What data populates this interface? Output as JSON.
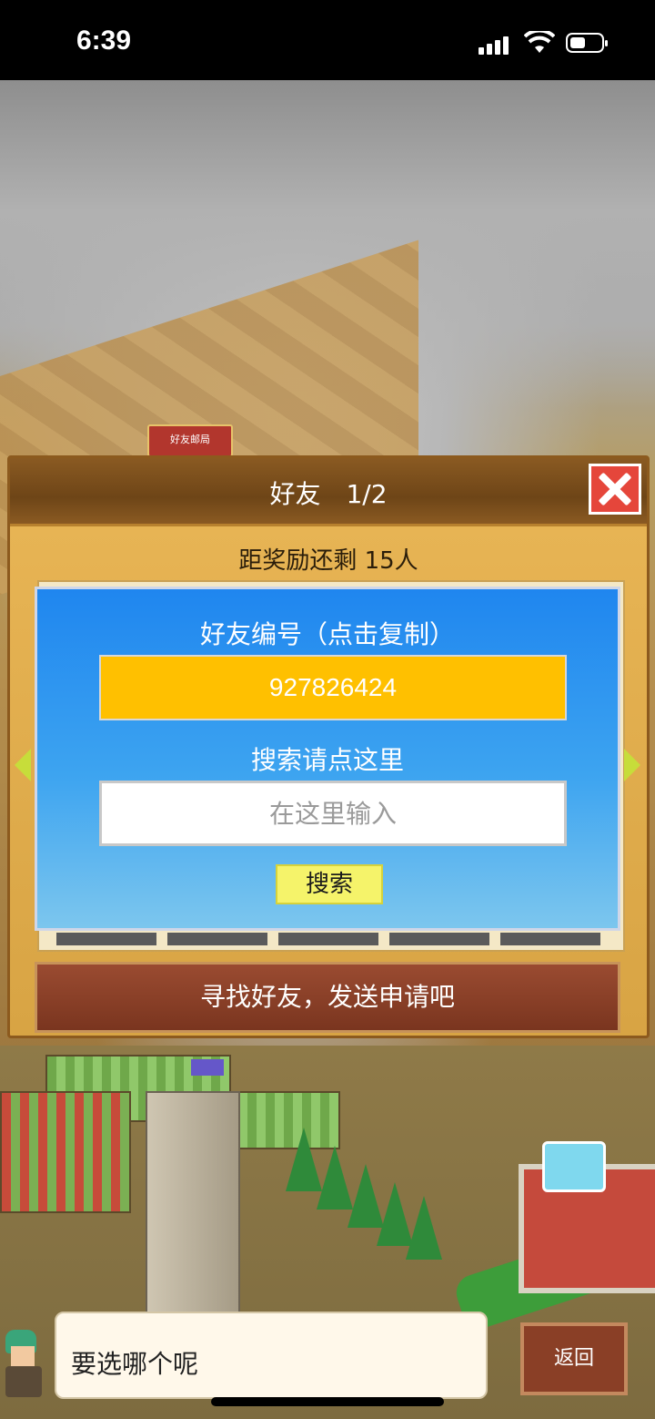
{
  "status_bar": {
    "time": "6:39"
  },
  "world": {
    "sign_label": "好友邮局"
  },
  "dialog": {
    "title": "好友　1/2",
    "reward_text": "距奖励还剩 15人",
    "friend_id_label": "好友编号（点击复制）",
    "friend_id_value": "927826424",
    "search_hint": "搜索请点这里",
    "search_placeholder": "在这里输入",
    "search_button": "搜索",
    "send_request_label": "寻找好友，发送申请吧"
  },
  "footer": {
    "speech": "要选哪个呢",
    "back_button": "返回"
  },
  "colors": {
    "dialog_bg": "#e9b656",
    "panel_blue": "#1f86ef",
    "id_box": "#ffc000",
    "close_red": "#e5463b",
    "search_yellow": "#f5f36a",
    "send_bar": "#8a3f26"
  },
  "icons": [
    "signal-icon",
    "wifi-icon",
    "battery-icon",
    "close-icon",
    "arrow-left-icon",
    "arrow-right-icon"
  ]
}
